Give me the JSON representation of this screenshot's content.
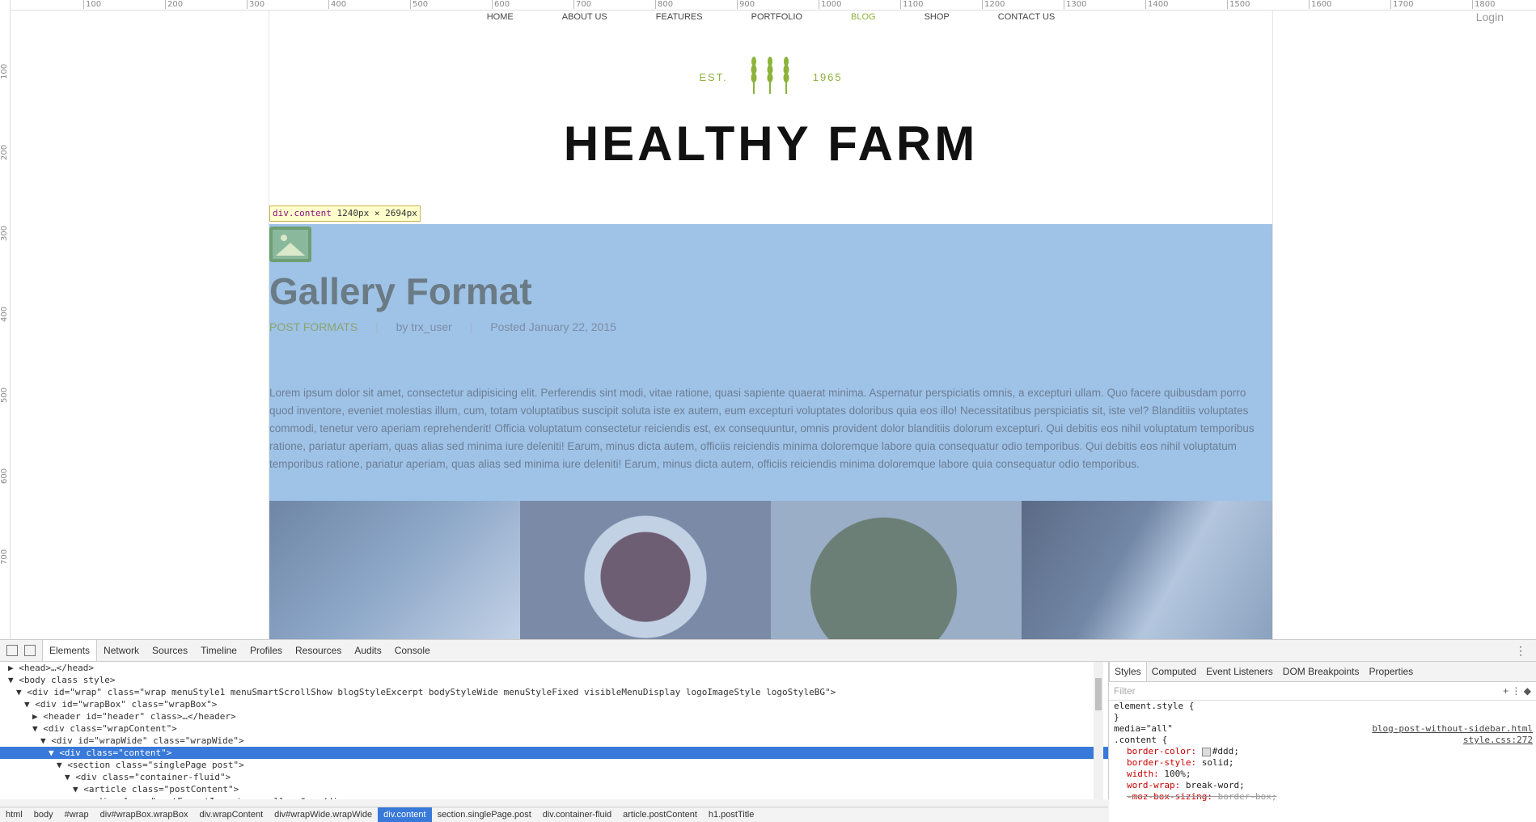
{
  "ruler": {
    "top": [
      "100",
      "200",
      "300",
      "400",
      "500",
      "600",
      "700",
      "800",
      "900",
      "1000",
      "1100",
      "1200",
      "1300",
      "1400",
      "1500",
      "1600",
      "1700",
      "1800"
    ],
    "left": [
      "100",
      "200",
      "300",
      "400",
      "500",
      "600",
      "700"
    ]
  },
  "nav": {
    "items": [
      "HOME",
      "ABOUT US",
      "FEATURES",
      "PORTFOLIO",
      "BLOG",
      "SHOP",
      "CONTACT US"
    ],
    "active": "BLOG",
    "login": "Login"
  },
  "logo": {
    "est": "EST.",
    "year": "1965",
    "title": "HEALTHY FARM"
  },
  "tooltip": {
    "selector": "div.content",
    "size": "1240px × 2694px"
  },
  "post": {
    "title": "Gallery Format",
    "category": "POST FORMATS",
    "author": "by trx_user",
    "date": "Posted January 22, 2015",
    "body": "Lorem ipsum dolor sit amet, consectetur adipisicing elit. Perferendis sint modi, vitae ratione, quasi sapiente quaerat minima. Aspernatur perspiciatis omnis, a excepturi ullam. Quo facere quibusdam porro quod inventore, eveniet molestias illum, cum, totam voluptatibus suscipit soluta iste ex autem, eum excepturi voluptates doloribus quia eos illo! Necessitatibus perspiciatis sit, iste vel? Blanditiis voluptates commodi, tenetur vero aperiam reprehenderit! Officia voluptatum consectetur reiciendis est, ex consequuntur, omnis provident dolor blanditiis dolorum excepturi. Qui debitis eos nihil voluptatum temporibus ratione, pariatur aperiam, quas alias sed minima iure deleniti! Earum, minus dicta autem, officiis reiciendis minima doloremque labore quia consequatur odio temporibus. Qui debitis eos nihil voluptatum temporibus ratione, pariatur aperiam, quas alias sed minima iure deleniti! Earum, minus dicta autem, officiis reiciendis minima doloremque labore quia consequatur odio temporibus."
  },
  "devtools": {
    "tabs": [
      "Elements",
      "Network",
      "Sources",
      "Timeline",
      "Profiles",
      "Resources",
      "Audits",
      "Console"
    ],
    "active_tab": "Elements",
    "dom": [
      {
        "indent": 1,
        "text": "▶ <head>…</head>"
      },
      {
        "indent": 1,
        "text": "▼ <body class style>"
      },
      {
        "indent": 2,
        "text": "▼ <div id=\"wrap\" class=\"wrap menuStyle1 menuSmartScrollShow blogStyleExcerpt bodyStyleWide menuStyleFixed visibleMenuDisplay logoImageStyle logoStyleBG\">"
      },
      {
        "indent": 3,
        "text": "▼ <div id=\"wrapBox\" class=\"wrapBox\">"
      },
      {
        "indent": 4,
        "text": "▶ <header id=\"header\" class>…</header>"
      },
      {
        "indent": 4,
        "text": "▼ <div class=\"wrapContent\">"
      },
      {
        "indent": 5,
        "text": "▼ <div id=\"wrapWide\" class=\"wrapWide\">"
      },
      {
        "indent": 6,
        "text": "▼ <div class=\"content\">",
        "selected": true
      },
      {
        "indent": 7,
        "text": "▼ <section class=\"singlePage post\">"
      },
      {
        "indent": 8,
        "text": "▼ <div class=\"container-fluid\">"
      },
      {
        "indent": 9,
        "text": "▼ <article class=\"postContent\">"
      },
      {
        "indent": 10,
        "text": "▶ <div class=\"postFormatIcon icon-gallery\">…</div>"
      }
    ],
    "breadcrumbs": [
      "html",
      "body",
      "#wrap",
      "div#wrapBox.wrapBox",
      "div.wrapContent",
      "div#wrapWide.wrapWide",
      "div.content",
      "section.singlePage.post",
      "div.container-fluid",
      "article.postContent",
      "h1.postTitle"
    ],
    "breadcrumb_selected": "div.content",
    "styles_tabs": [
      "Styles",
      "Computed",
      "Event Listeners",
      "DOM Breakpoints",
      "Properties"
    ],
    "styles_active": "Styles",
    "filter_placeholder": "Filter",
    "filter_actions": "+ ⋮ ◆",
    "css": [
      {
        "text": "element.style {",
        "indent": false
      },
      {
        "text": "}",
        "indent": false
      },
      {
        "text": "media=\"all\"",
        "indent": false,
        "src": "blog-post-without-sidebar.html"
      },
      {
        "text": ".content {",
        "indent": false,
        "src": "style.css:272"
      },
      {
        "prop": "border-color",
        "value": "#ddd;",
        "swatch": true,
        "indent": true
      },
      {
        "prop": "border-style",
        "value": "solid;",
        "indent": true
      },
      {
        "prop": "width",
        "value": "100%;",
        "indent": true
      },
      {
        "prop": "word-wrap",
        "value": "break-word;",
        "indent": true
      },
      {
        "prop": "-moz-box-sizing",
        "value": "border-box;",
        "indent": true,
        "strike": true
      }
    ]
  }
}
